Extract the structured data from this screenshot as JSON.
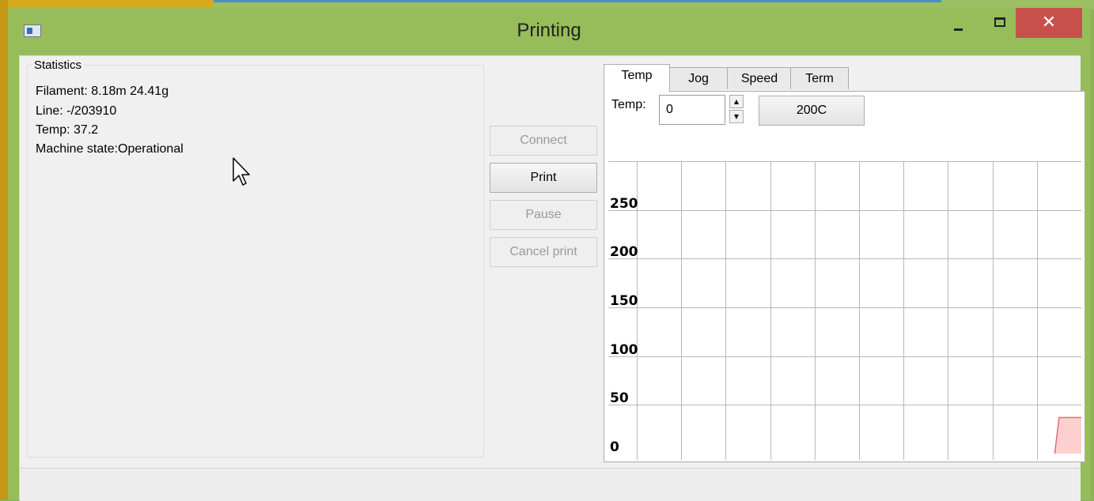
{
  "window": {
    "title": "Printing",
    "close_glyph": "✕",
    "icons": [
      "app-icon",
      "minimize-icon",
      "maximize-icon",
      "close-icon"
    ]
  },
  "statistics": {
    "legend": "Statistics",
    "filament": "Filament: 8.18m 24.41g",
    "line": "Line: -/203910",
    "temp": "Temp: 37.2",
    "machine_state": "Machine state:Operational"
  },
  "buttons": {
    "connect": "Connect",
    "print": "Print",
    "pause": "Pause",
    "cancel_print": "Cancel print"
  },
  "tabs": [
    "Temp",
    "Jog",
    "Speed",
    "Term"
  ],
  "active_tab": "Temp",
  "temp_panel": {
    "label": "Temp:",
    "input_value": "0",
    "preset_button": "200C"
  },
  "chart_data": {
    "type": "area",
    "title": "",
    "xlabel": "",
    "ylabel": "",
    "ylim": [
      0,
      300
    ],
    "yticks": [
      0,
      50,
      100,
      150,
      200,
      250
    ],
    "grid": true,
    "series": [
      {
        "color": "#e07070",
        "fill": "#fdd0d0",
        "x": [
          0,
          94,
          95,
          100
        ],
        "values": [
          0,
          0,
          37,
          37
        ]
      }
    ]
  },
  "colors": {
    "window_frame": "#97bd5a",
    "close_button": "#c8504a",
    "temp_line": "#e07070",
    "temp_fill": "#fdd0d0"
  }
}
